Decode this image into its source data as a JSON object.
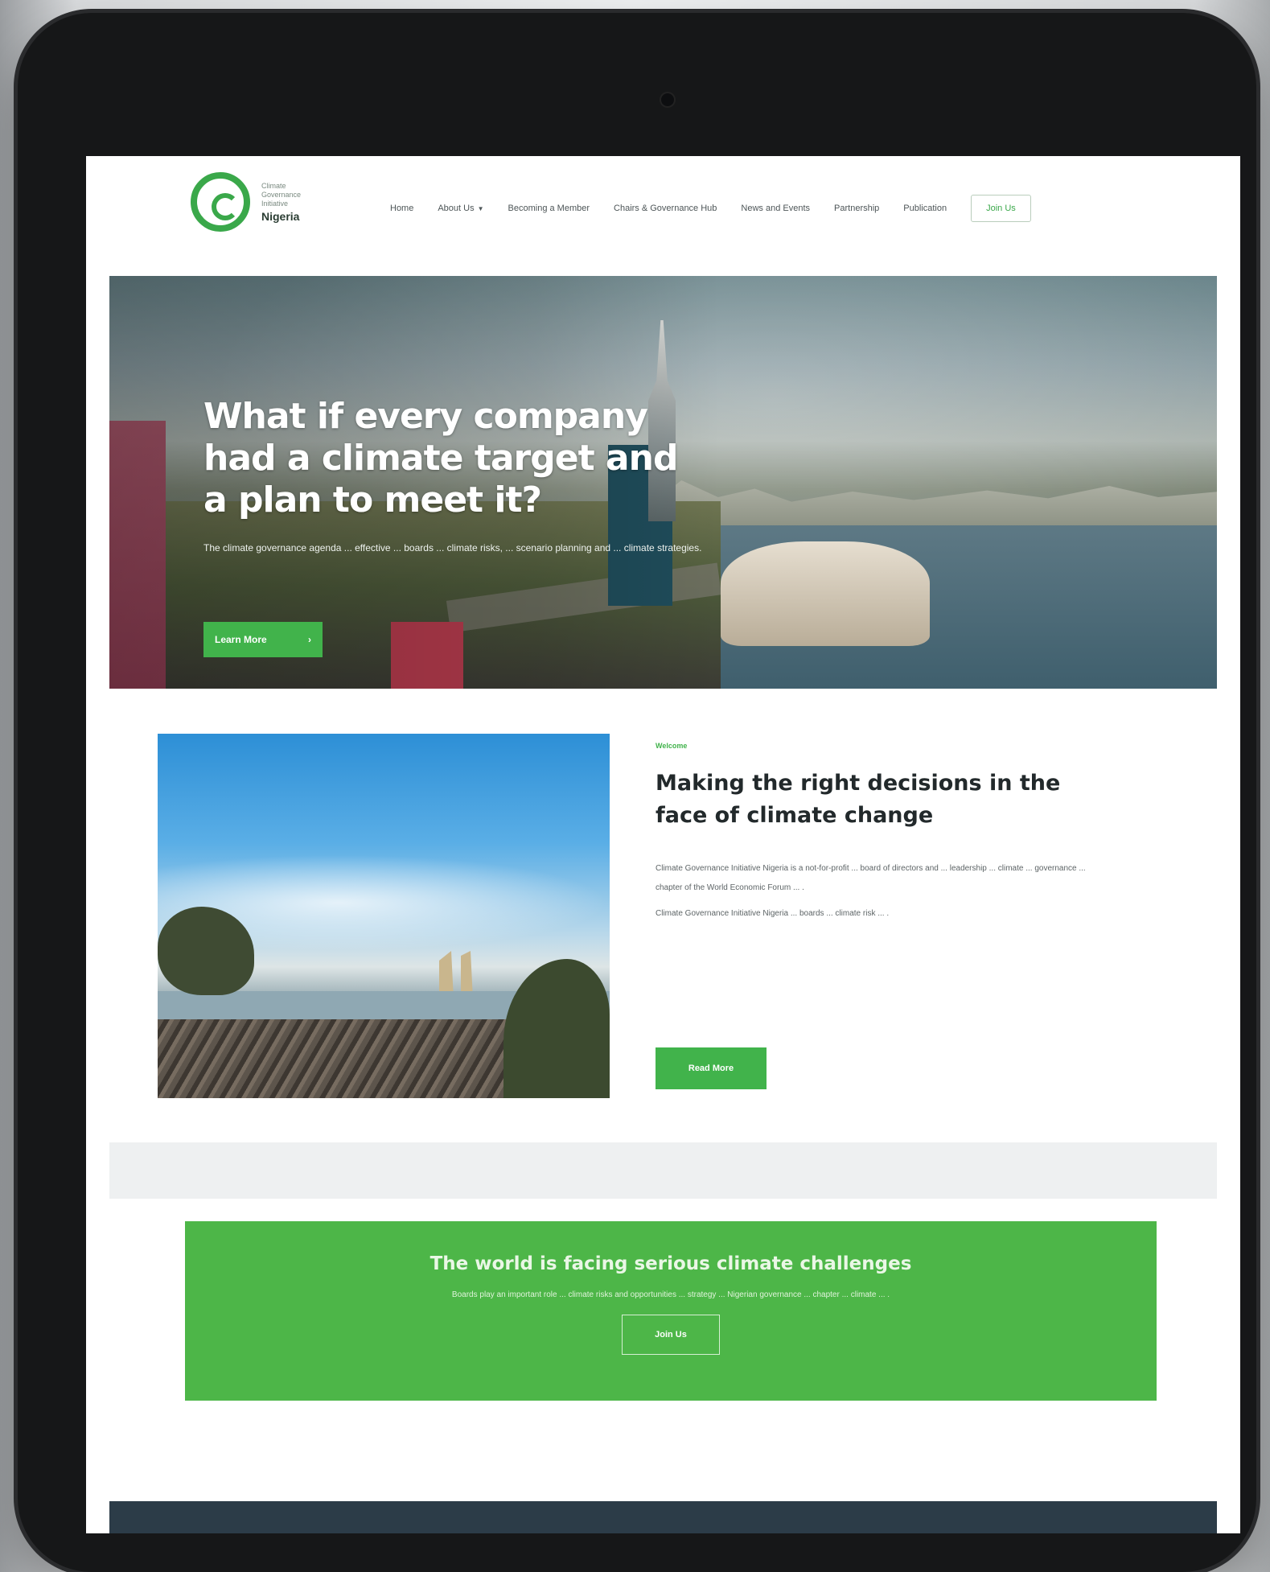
{
  "header": {
    "logo": {
      "lines": [
        "Climate",
        "Governance",
        "Initiative"
      ],
      "country": "Nigeria"
    },
    "nav": [
      {
        "label": "Home"
      },
      {
        "label": "About Us"
      },
      {
        "label": "Becoming a Member"
      },
      {
        "label": "Chairs & Governance Hub"
      },
      {
        "label": "News and Events"
      },
      {
        "label": "Partnership"
      },
      {
        "label": "Publication"
      }
    ],
    "nav_button": "Join Us"
  },
  "hero": {
    "title_lines": [
      "What if every company",
      "had a climate target and",
      "a plan to meet it?"
    ],
    "text": "The climate governance agenda ... effective ... boards ... climate risks, ... scenario planning and ... climate strategies.",
    "button_label": "Learn More",
    "button_icon": "arrow-right-icon"
  },
  "about": {
    "eyebrow": "Welcome",
    "title": "Making the right decisions in the face of climate change",
    "paragraphs": [
      "Climate Governance Initiative Nigeria is a not-for-profit ... board of directors and ... leadership ... climate ... governance ... chapter of the World Economic Forum ... .",
      "Climate Governance Initiative Nigeria ... boards ... climate risk ... ."
    ],
    "button_label": "Read More"
  },
  "cta": {
    "title": "The world is facing serious climate challenges",
    "text": "Boards play an important role ... climate risks and opportunities ... strategy ... Nigerian governance ... chapter ... climate ... .",
    "button_label": "Join Us"
  },
  "colors": {
    "brand_green": "#41b34b",
    "cta_green": "#4db648",
    "dark_text": "#22292b",
    "footer_dark": "#2c3c48"
  }
}
